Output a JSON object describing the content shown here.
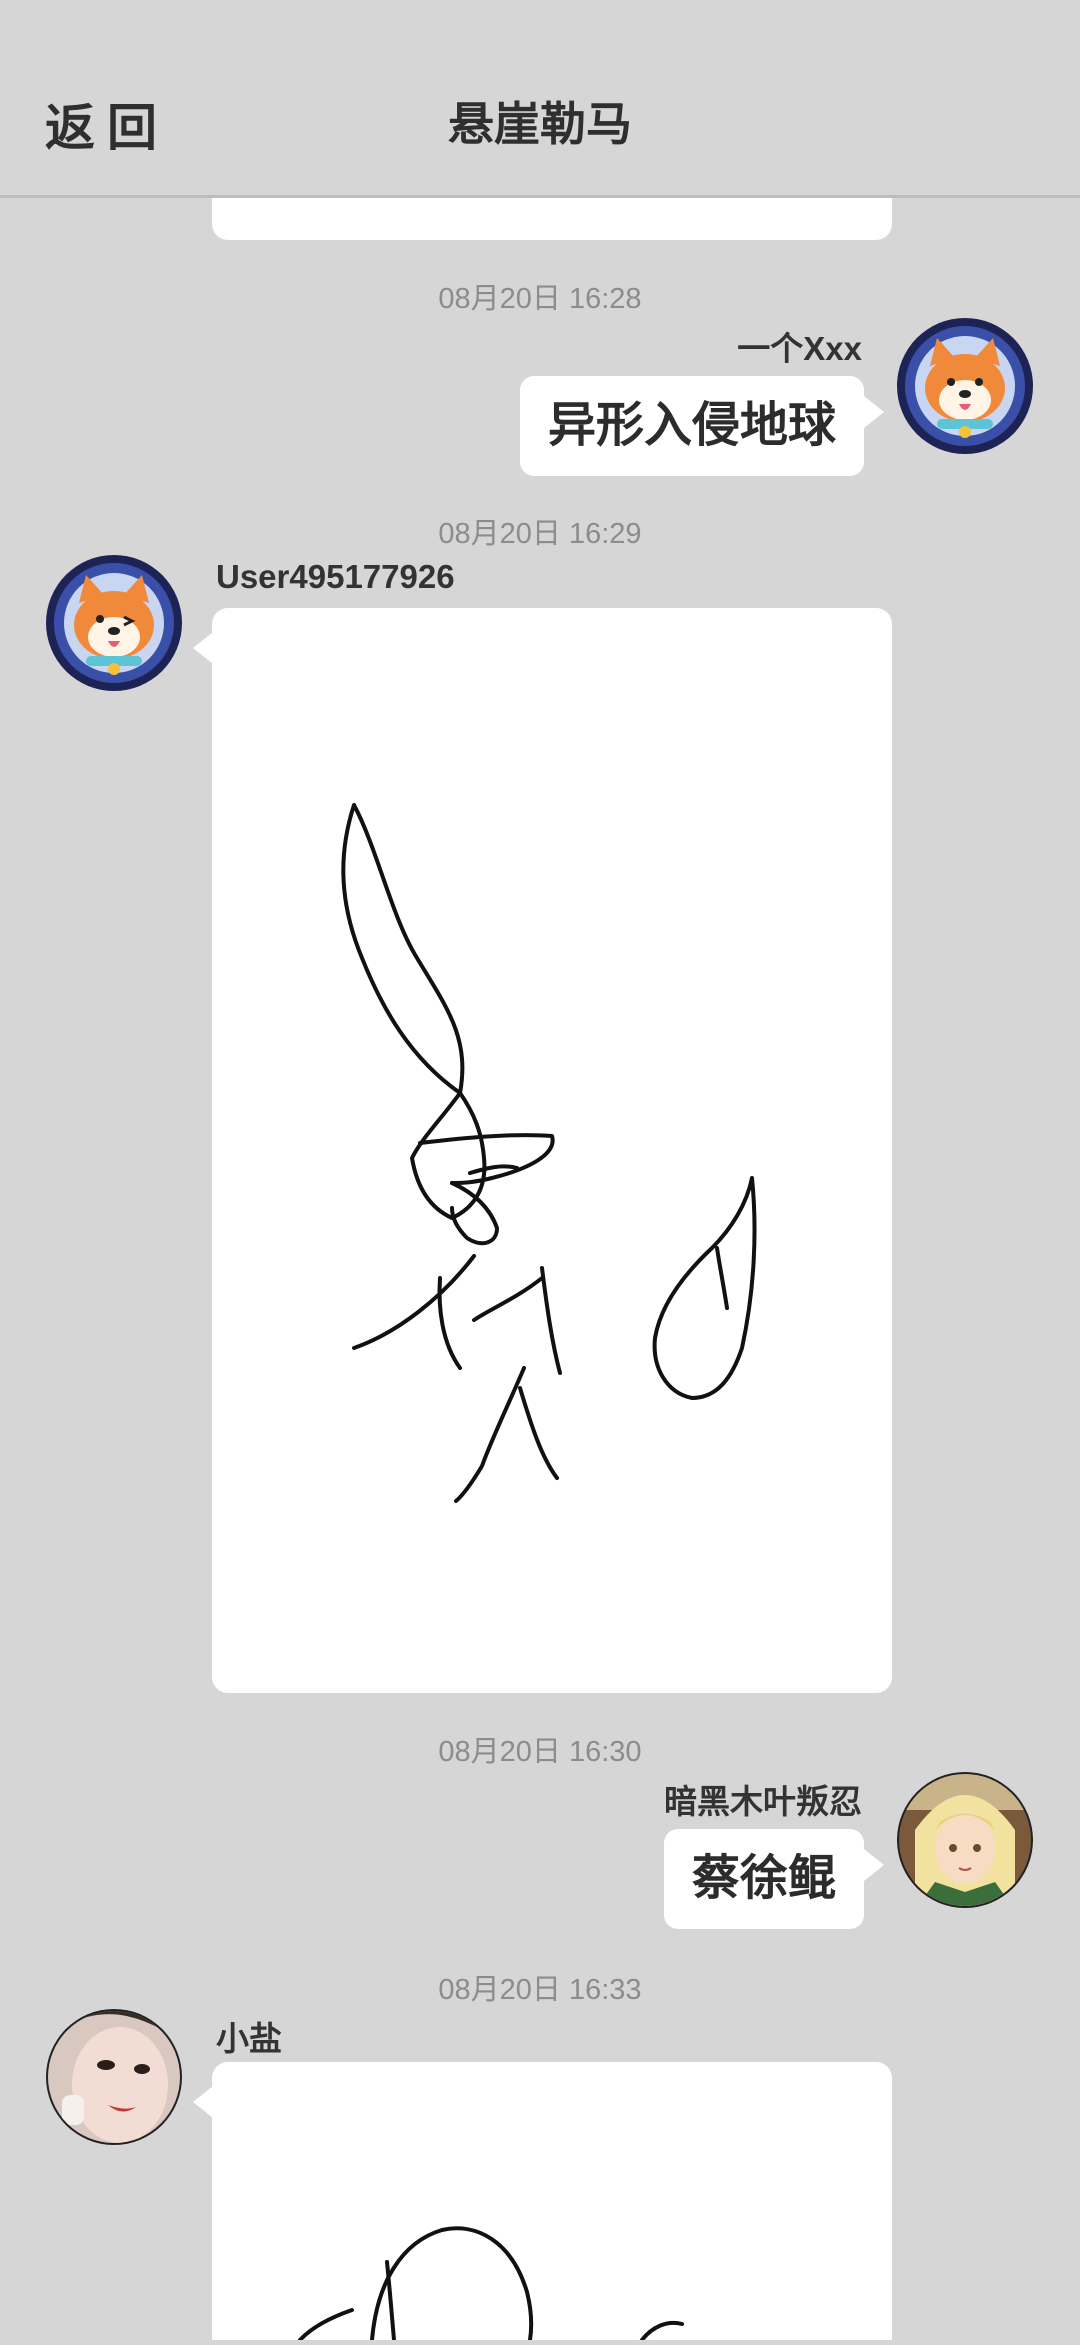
{
  "header": {
    "back_label": "返回",
    "title": "悬崖勒马"
  },
  "messages": [
    {
      "time": "08月20日  16:28",
      "sender": "一个Xxx",
      "text": "异形入侵地球"
    },
    {
      "time": "08月20日  16:29",
      "sender": "User495177926"
    },
    {
      "time": "08月20日  16:30",
      "sender": "暗黑木叶叛忍",
      "text": "蔡徐鲲"
    },
    {
      "time": "08月20日  16:33",
      "sender": "小盐"
    }
  ]
}
